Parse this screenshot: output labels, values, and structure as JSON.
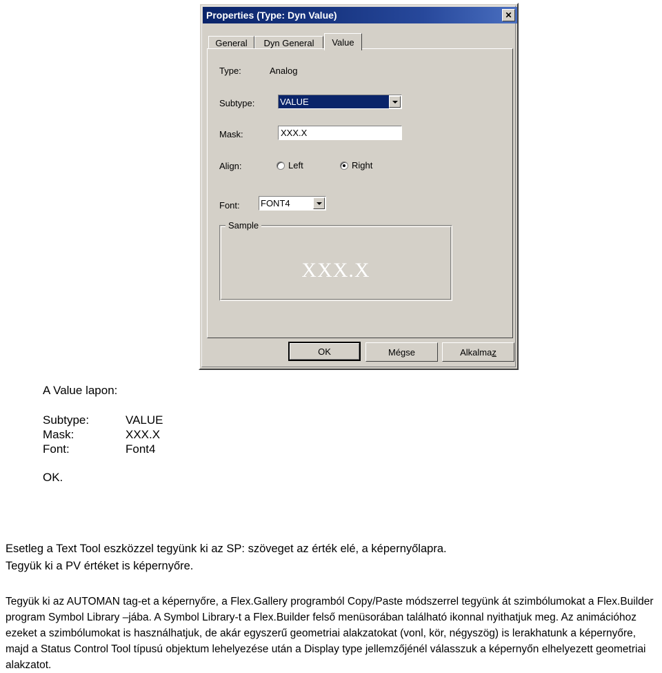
{
  "dialog": {
    "title": "Properties (Type: Dyn Value)",
    "close_button": "✕",
    "close_icon_name": "close-icon",
    "tabs": [
      {
        "label": "General",
        "active": false
      },
      {
        "label": "Dyn General",
        "active": false
      },
      {
        "label": "Value",
        "active": true
      }
    ],
    "fields": {
      "type_label": "Type:",
      "type_value": "Analog",
      "subtype_label": "Subtype:",
      "subtype_value": "VALUE",
      "mask_label": "Mask:",
      "mask_value": "XXX.X",
      "align_label": "Align:",
      "align_left_label": "Left",
      "align_right_label": "Right",
      "align_selected": "Right",
      "font_label": "Font:",
      "font_value": "FONT4"
    },
    "sample": {
      "title": "Sample",
      "text": "XXX.X"
    },
    "buttons": {
      "ok": "OK",
      "cancel": "Mégse",
      "apply_pre": "Alkalma",
      "apply_accel": "z"
    },
    "colors": {
      "titlebar_start": "#0a246a",
      "titlebar_end": "#4a6fc0",
      "face": "#d4d0c8",
      "selection": "#0a246a",
      "sample_text": "#ffffff"
    }
  },
  "document": {
    "heading": "A Value lapon:",
    "settings": [
      {
        "key": "Subtype:",
        "value": "VALUE"
      },
      {
        "key": "Mask:",
        "value": "XXX.X"
      },
      {
        "key": "Font:",
        "value": "Font4"
      }
    ],
    "ok_line": "OK.",
    "paragraph_a": [
      "Esetleg a Text Tool eszközzel tegyünk ki az SP: szöveget az érték elé, a képernyőlapra.",
      "Tegyük ki a PV értéket is képernyőre."
    ],
    "paragraph_b": "Tegyük ki az AUTOMAN tag-et a képernyőre, a Flex.Gallery programból Copy/Paste módszerrel tegyünk át szimbólumokat a Flex.Builder program Symbol Library –jába. A Symbol Library-t a Flex.Builder felső menüsorában található ikonnal nyithatjuk meg. Az animációhoz ezeket a szimbólumokat is használhatjuk, de akár egyszerű geometriai alakzatokat (vonl, kör, négyszög) is lerakhatunk a képernyőre, majd a Status Control Tool típusú objektum lehelyezése után a Display type jellemzőjénél válasszuk a képernyőn elhelyezett geometriai alakzatot."
  }
}
